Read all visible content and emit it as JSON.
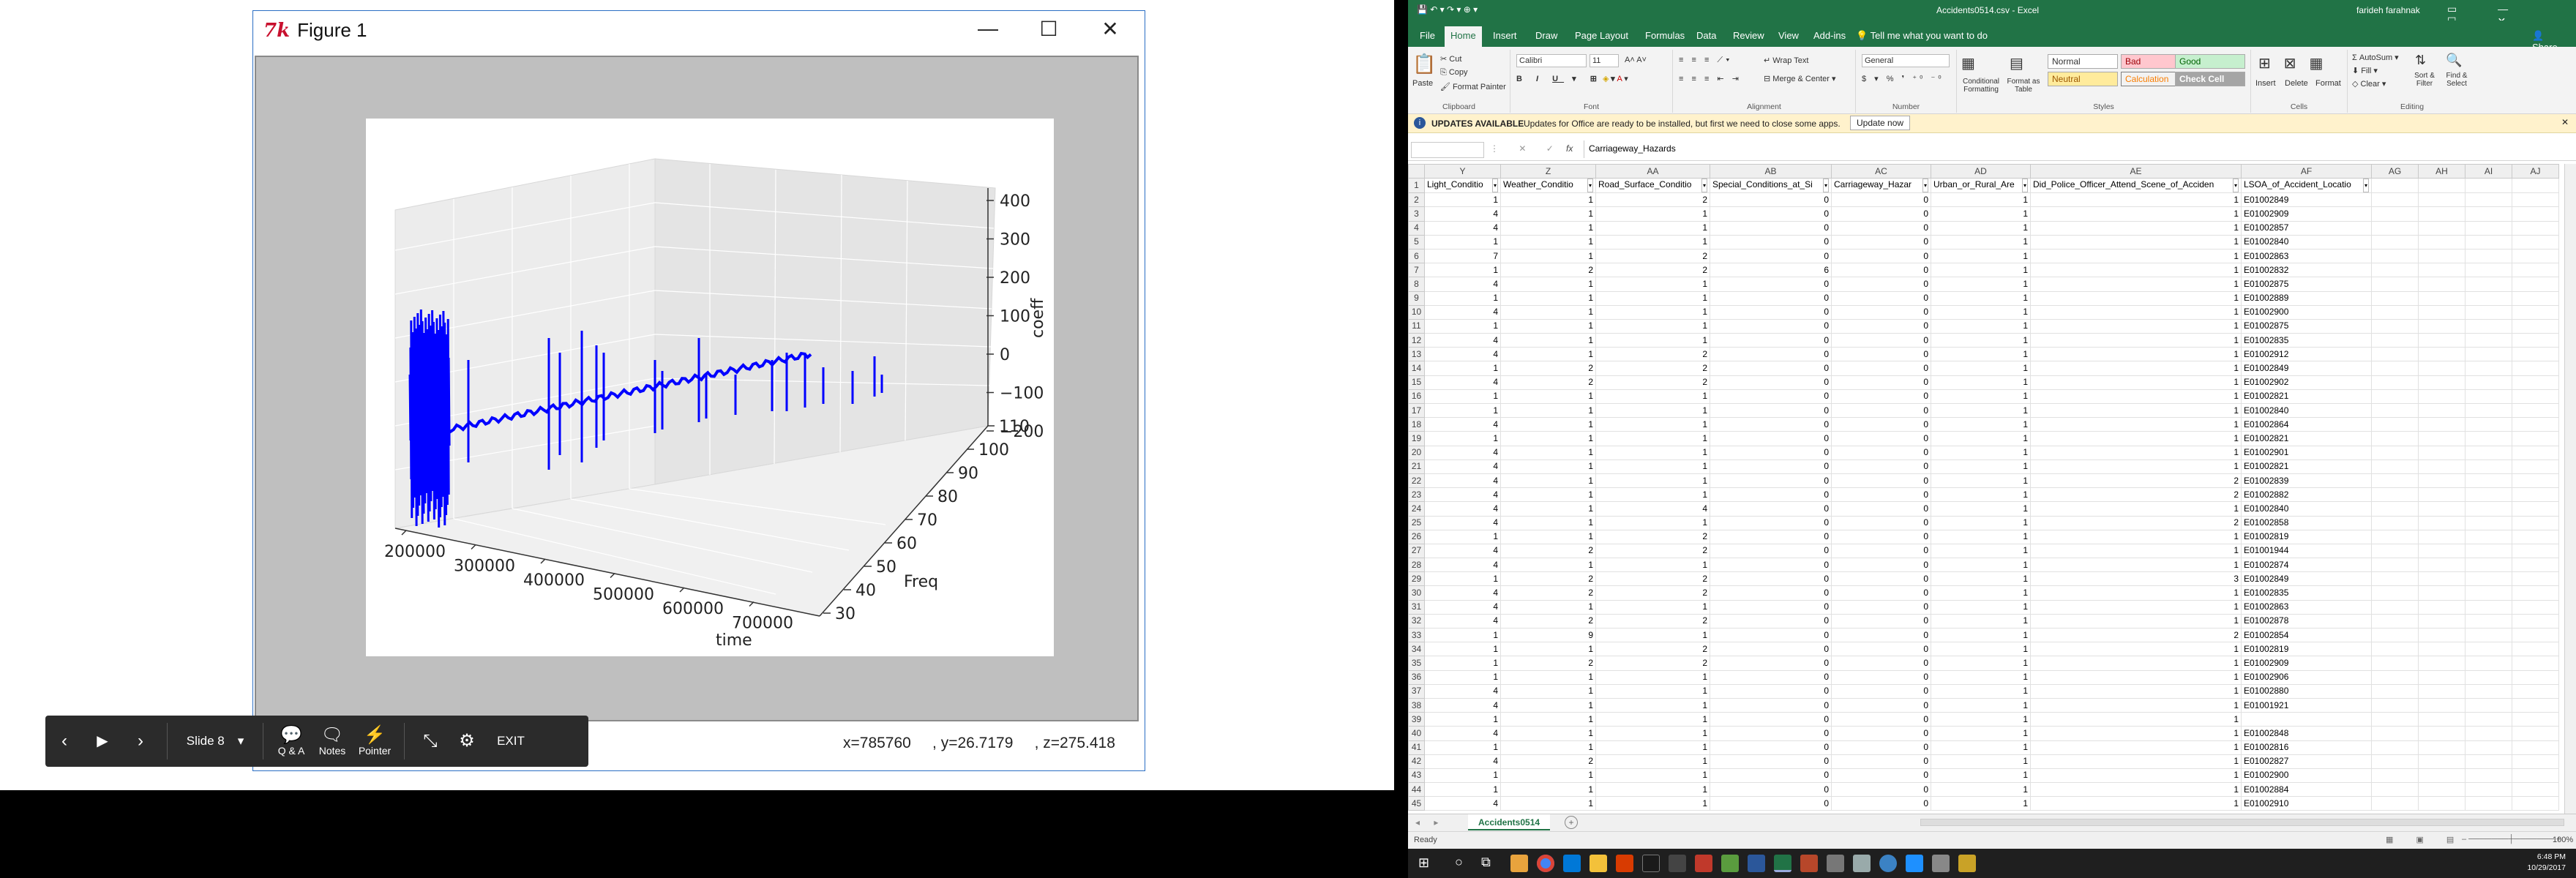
{
  "figure": {
    "title": "Figure 1",
    "minimize_glyph": "—",
    "maximize_glyph": "☐",
    "close_glyph": "✕",
    "coords_x": "x=785760",
    "coords_y": ", y=26.7179",
    "coords_z": ", z=275.418",
    "plot": {
      "z_ticks": [
        "400",
        "300",
        "200",
        "100",
        "0",
        "−100",
        "−200"
      ],
      "zlabel": "coeff",
      "x_ticks": [
        "200000",
        "300000",
        "400000",
        "500000",
        "600000",
        "700000"
      ],
      "xlabel": "time",
      "y_ticks": [
        "30",
        "40",
        "50",
        "60",
        "70",
        "80",
        "90",
        "100",
        "110"
      ],
      "ylabel": "Freq",
      "line_color": "#0000ff"
    }
  },
  "slideshow": {
    "prev_icon": "‹",
    "play_icon": "▶",
    "next_icon": "›",
    "slide_label": "Slide 8",
    "dropdown_icon": "▾",
    "qa_label": "Q & A",
    "notes_label": "Notes",
    "pointer_label": "Pointer",
    "exit_label": "EXIT"
  },
  "excel": {
    "doc_title": "Accidents0514.csv - Excel",
    "user": "farideh farahnak",
    "tabs": [
      "File",
      "Home",
      "Insert",
      "Draw",
      "Page Layout",
      "Formulas",
      "Data",
      "Review",
      "View",
      "Add-ins"
    ],
    "tell_me": "Tell me what you want to do",
    "share": "Share",
    "clipboard": {
      "paste": "Paste",
      "cut": "Cut",
      "copy": "Copy",
      "format_painter": "Format Painter",
      "name": "Clipboard"
    },
    "font": {
      "family": "Calibri",
      "size": "11",
      "name": "Font"
    },
    "alignment": {
      "wrap": "Wrap Text",
      "merge": "Merge & Center",
      "name": "Alignment"
    },
    "number": {
      "format": "General",
      "name": "Number"
    },
    "styles": {
      "cond": "Conditional Formatting",
      "fmt_table": "Format as Table",
      "normal": "Normal",
      "bad": "Bad",
      "good": "Good",
      "neutral": "Neutral",
      "calculation": "Calculation",
      "check_cell": "Check Cell",
      "name": "Styles"
    },
    "cells": {
      "insert": "Insert",
      "delete": "Delete",
      "format": "Format",
      "name": "Cells"
    },
    "editing": {
      "autosum": "AutoSum",
      "fill": "Fill",
      "clear": "Clear",
      "sort": "Sort & Filter",
      "find": "Find & Select",
      "name": "Editing"
    },
    "message": {
      "title": "UPDATES AVAILABLE",
      "text": "Updates for Office are ready to be installed, but first we need to close some apps.",
      "button": "Update now"
    },
    "formula_bar": {
      "fx": "fx",
      "content": "Carriageway_Hazards"
    },
    "columns": [
      "Y",
      "Z",
      "AA",
      "AB",
      "AC",
      "AD",
      "AE",
      "AF",
      "AG",
      "AH",
      "AI",
      "AJ"
    ],
    "headers": [
      "Light_Conditio",
      "Weather_Conditio",
      "Road_Surface_Conditio",
      "Special_Conditions_at_Si",
      "Carriageway_Hazar",
      "Urban_or_Rural_Are",
      "Did_Police_Officer_Attend_Scene_of_Acciden",
      "LSOA_of_Accident_Locatio"
    ],
    "rows": [
      [
        "1",
        "1",
        "2",
        "0",
        "0",
        "1",
        "1",
        "E01002849"
      ],
      [
        "4",
        "1",
        "1",
        "0",
        "0",
        "1",
        "1",
        "E01002909"
      ],
      [
        "4",
        "1",
        "1",
        "0",
        "0",
        "1",
        "1",
        "E01002857"
      ],
      [
        "1",
        "1",
        "1",
        "0",
        "0",
        "1",
        "1",
        "E01002840"
      ],
      [
        "7",
        "1",
        "2",
        "0",
        "0",
        "1",
        "1",
        "E01002863"
      ],
      [
        "1",
        "2",
        "2",
        "6",
        "0",
        "1",
        "1",
        "E01002832"
      ],
      [
        "4",
        "1",
        "1",
        "0",
        "0",
        "1",
        "1",
        "E01002875"
      ],
      [
        "1",
        "1",
        "1",
        "0",
        "0",
        "1",
        "1",
        "E01002889"
      ],
      [
        "4",
        "1",
        "1",
        "0",
        "0",
        "1",
        "1",
        "E01002900"
      ],
      [
        "1",
        "1",
        "1",
        "0",
        "0",
        "1",
        "1",
        "E01002875"
      ],
      [
        "4",
        "1",
        "1",
        "0",
        "0",
        "1",
        "1",
        "E01002835"
      ],
      [
        "4",
        "1",
        "2",
        "0",
        "0",
        "1",
        "1",
        "E01002912"
      ],
      [
        "1",
        "2",
        "2",
        "0",
        "0",
        "1",
        "1",
        "E01002849"
      ],
      [
        "4",
        "2",
        "2",
        "0",
        "0",
        "1",
        "1",
        "E01002902"
      ],
      [
        "1",
        "1",
        "1",
        "0",
        "0",
        "1",
        "1",
        "E01002821"
      ],
      [
        "1",
        "1",
        "1",
        "0",
        "0",
        "1",
        "1",
        "E01002840"
      ],
      [
        "4",
        "1",
        "1",
        "0",
        "0",
        "1",
        "1",
        "E01002864"
      ],
      [
        "1",
        "1",
        "1",
        "0",
        "0",
        "1",
        "1",
        "E01002821"
      ],
      [
        "4",
        "1",
        "1",
        "0",
        "0",
        "1",
        "1",
        "E01002901"
      ],
      [
        "4",
        "1",
        "1",
        "0",
        "0",
        "1",
        "1",
        "E01002821"
      ],
      [
        "4",
        "1",
        "1",
        "0",
        "0",
        "1",
        "2",
        "E01002839"
      ],
      [
        "4",
        "1",
        "1",
        "0",
        "0",
        "1",
        "2",
        "E01002882"
      ],
      [
        "4",
        "1",
        "4",
        "0",
        "0",
        "1",
        "1",
        "E01002840"
      ],
      [
        "4",
        "1",
        "1",
        "0",
        "0",
        "1",
        "2",
        "E01002858"
      ],
      [
        "1",
        "1",
        "2",
        "0",
        "0",
        "1",
        "1",
        "E01002819"
      ],
      [
        "4",
        "2",
        "2",
        "0",
        "0",
        "1",
        "1",
        "E01001944"
      ],
      [
        "4",
        "1",
        "1",
        "0",
        "0",
        "1",
        "1",
        "E01002874"
      ],
      [
        "1",
        "2",
        "2",
        "0",
        "0",
        "1",
        "3",
        "E01002849"
      ],
      [
        "4",
        "2",
        "2",
        "0",
        "0",
        "1",
        "1",
        "E01002835"
      ],
      [
        "4",
        "1",
        "1",
        "0",
        "0",
        "1",
        "1",
        "E01002863"
      ],
      [
        "4",
        "2",
        "2",
        "0",
        "0",
        "1",
        "1",
        "E01002878"
      ],
      [
        "1",
        "9",
        "1",
        "0",
        "0",
        "1",
        "2",
        "E01002854"
      ],
      [
        "1",
        "1",
        "2",
        "0",
        "0",
        "1",
        "1",
        "E01002819"
      ],
      [
        "1",
        "2",
        "2",
        "0",
        "0",
        "1",
        "1",
        "E01002909"
      ],
      [
        "1",
        "1",
        "1",
        "0",
        "0",
        "1",
        "1",
        "E01002906"
      ],
      [
        "4",
        "1",
        "1",
        "0",
        "0",
        "1",
        "1",
        "E01002880"
      ],
      [
        "4",
        "1",
        "1",
        "0",
        "0",
        "1",
        "1",
        "E01001921"
      ],
      [
        "1",
        "1",
        "1",
        "0",
        "0",
        "1",
        "1",
        ""
      ],
      [
        "4",
        "1",
        "1",
        "0",
        "0",
        "1",
        "1",
        "E01002848"
      ],
      [
        "1",
        "1",
        "1",
        "0",
        "0",
        "1",
        "1",
        "E01002816"
      ],
      [
        "4",
        "2",
        "1",
        "0",
        "0",
        "1",
        "1",
        "E01002827"
      ],
      [
        "1",
        "1",
        "1",
        "0",
        "0",
        "1",
        "1",
        "E01002900"
      ],
      [
        "1",
        "1",
        "1",
        "0",
        "0",
        "1",
        "1",
        "E01002884"
      ],
      [
        "4",
        "1",
        "1",
        "0",
        "0",
        "1",
        "1",
        "E01002910"
      ]
    ],
    "sheet_tab": "Accidents0514",
    "status_ready": "Ready",
    "zoom": "100%"
  },
  "taskbar": {
    "time": "6:48 PM",
    "date": "10/29/2017"
  }
}
